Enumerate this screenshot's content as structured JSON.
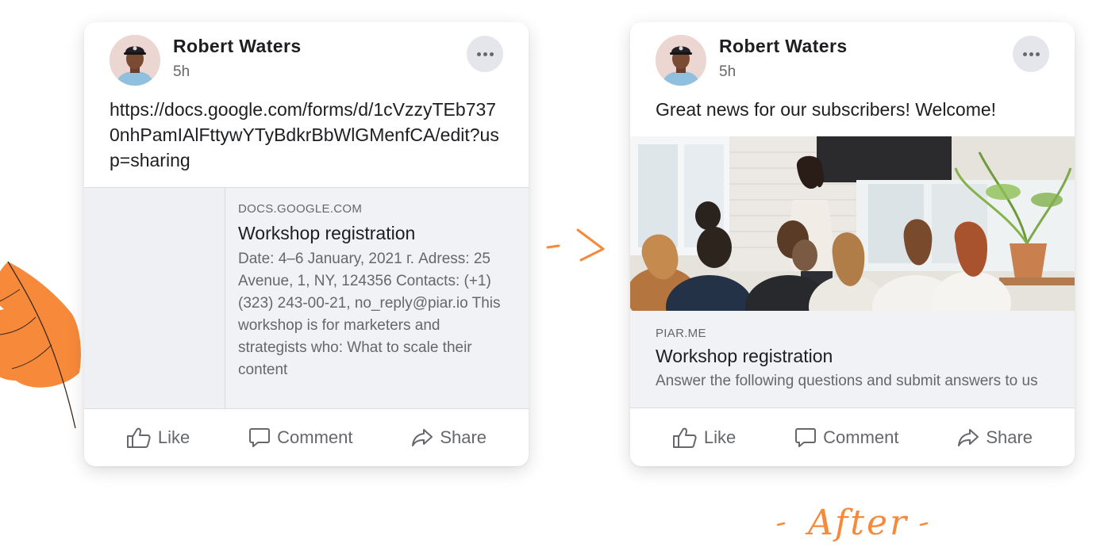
{
  "accent_color": "#f7893b",
  "before_post": {
    "author": "Robert Waters",
    "time": "5h",
    "text": "https://docs.google.com/forms/d/1cVzzyTEb7370nhPamIAlFttywYTyBdkrBbWlGMenfCA/edit?usp=sharing",
    "link_preview": {
      "domain": "DOCS.GOOGLE.COM",
      "title": "Workshop registration",
      "description": "Date: 4–6 January, 2021 г. Adress: 25 Avenue, 1, NY, 124356 Contacts: (+1) (323) 243-00-21, no_reply@piar.io This workshop is for marketers and strategists who: What to scale their content"
    }
  },
  "after_post": {
    "author": "Robert Waters",
    "time": "5h",
    "text": "Great news for our subscribers! Welcome!",
    "image": "workshop-presentation-photo",
    "link_preview": {
      "domain": "PIAR.ME",
      "title": "Workshop registration",
      "description": "Answer the following questions and submit answers to us"
    }
  },
  "actions": {
    "like": "Like",
    "comment": "Comment",
    "share": "Share"
  },
  "icons": [
    "more-icon",
    "like-icon",
    "comment-icon",
    "share-icon",
    "arrow-icon",
    "leaf-icon"
  ],
  "after_label": "After"
}
